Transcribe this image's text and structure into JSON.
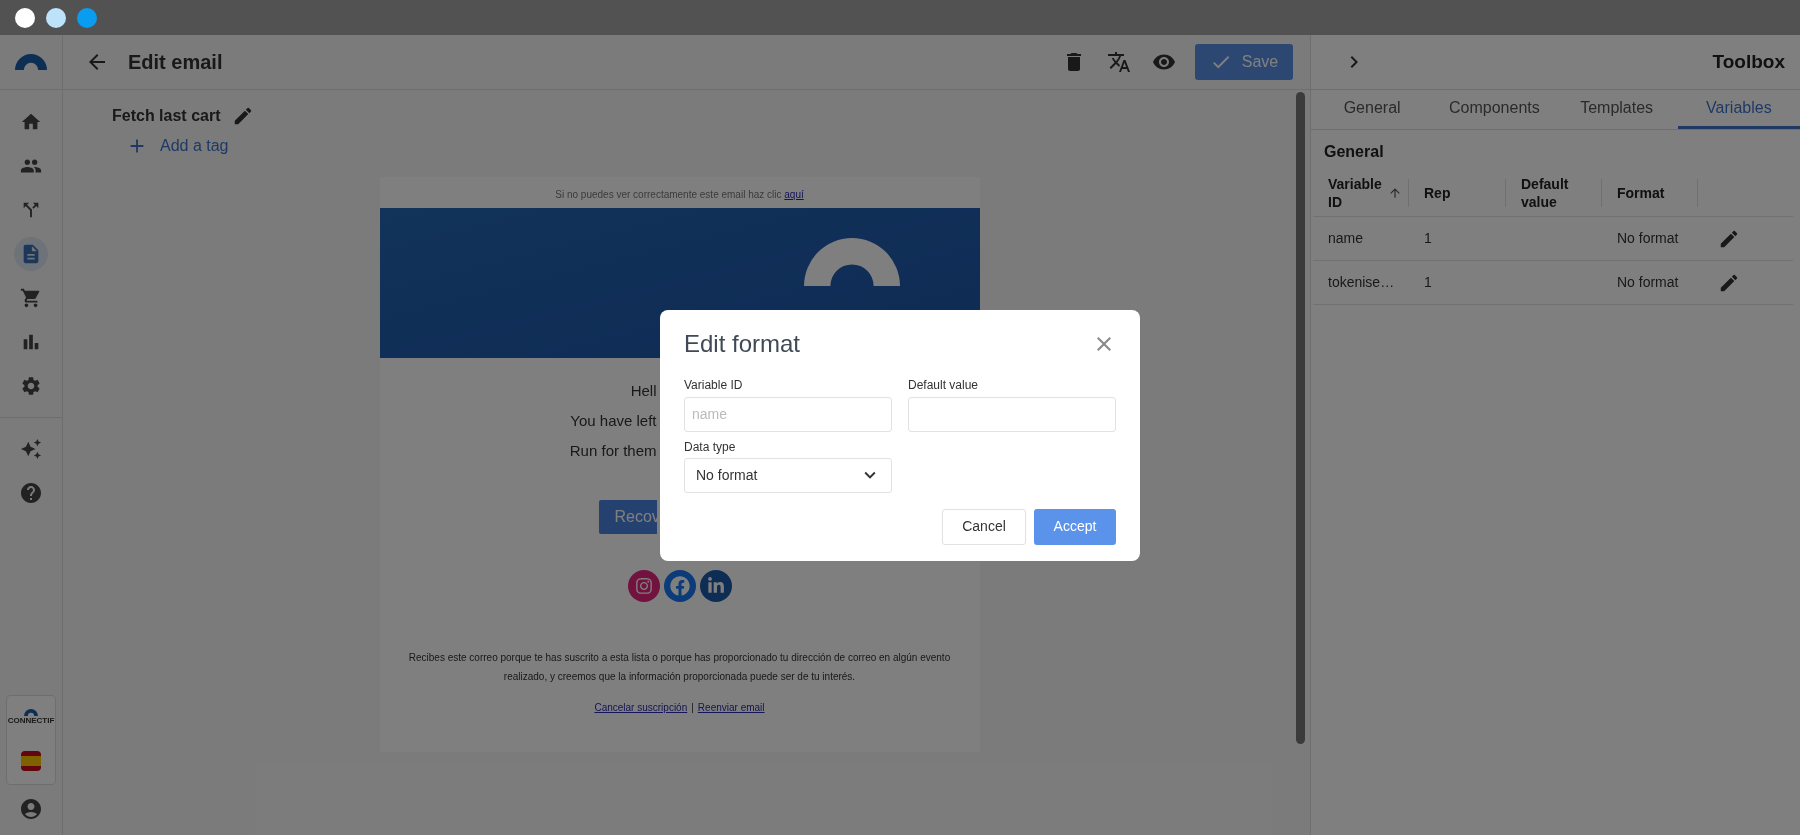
{
  "window_controls": [
    {
      "color": "#ffffff"
    },
    {
      "color": "#bde3fb"
    },
    {
      "color": "#0a9cf0"
    }
  ],
  "sidebar": {
    "items": [
      {
        "selected": false
      },
      {
        "selected": false
      },
      {
        "selected": false
      },
      {
        "selected": true
      },
      {
        "selected": false
      },
      {
        "selected": false
      },
      {
        "selected": false
      }
    ],
    "brand": "CONNECTIF"
  },
  "header": {
    "title": "Edit email",
    "save_label": "Save"
  },
  "email_name": "Fetch last cart",
  "add_tag": "Add a tag",
  "email": {
    "preheader": "Si no puedes ver correctamente este email haz clic ",
    "preheader_link": "aquí",
    "lines": [
      "Hell",
      "You have left",
      "Run for them"
    ],
    "button": "Recov",
    "footer": "Recibes este correo porque te has suscrito a esta lista o porque has proporcionado tu dirección de correo en algún evento realizado, y creemos que la información proporcionada puede ser de tu interés.",
    "links": [
      "Cancelar suscripción",
      "Reenviar email"
    ],
    "link_separator": "|"
  },
  "toolbox": {
    "title": "Toolbox",
    "tabs": [
      {
        "label": "General",
        "selected": false
      },
      {
        "label": "Components",
        "selected": false
      },
      {
        "label": "Templates",
        "selected": false
      },
      {
        "label": "Variables",
        "selected": true
      }
    ],
    "section": "General",
    "columns": [
      {
        "label": "Variable ID",
        "sorted": true
      },
      {
        "label": "Rep",
        "sorted": false
      },
      {
        "label": "Default value",
        "sorted": false
      },
      {
        "label": "Format",
        "sorted": false
      }
    ],
    "rows": [
      {
        "id": "name",
        "rep": "1",
        "default": "",
        "format": "No format"
      },
      {
        "id": "tokenise…",
        "rep": "1",
        "default": "",
        "format": "No format"
      }
    ]
  },
  "modal": {
    "title": "Edit format",
    "variable_label": "Variable ID",
    "variable_placeholder": "name",
    "default_label": "Default value",
    "type_label": "Data type",
    "type_value": "No format",
    "cancel": "Cancel",
    "accept": "Accept"
  }
}
